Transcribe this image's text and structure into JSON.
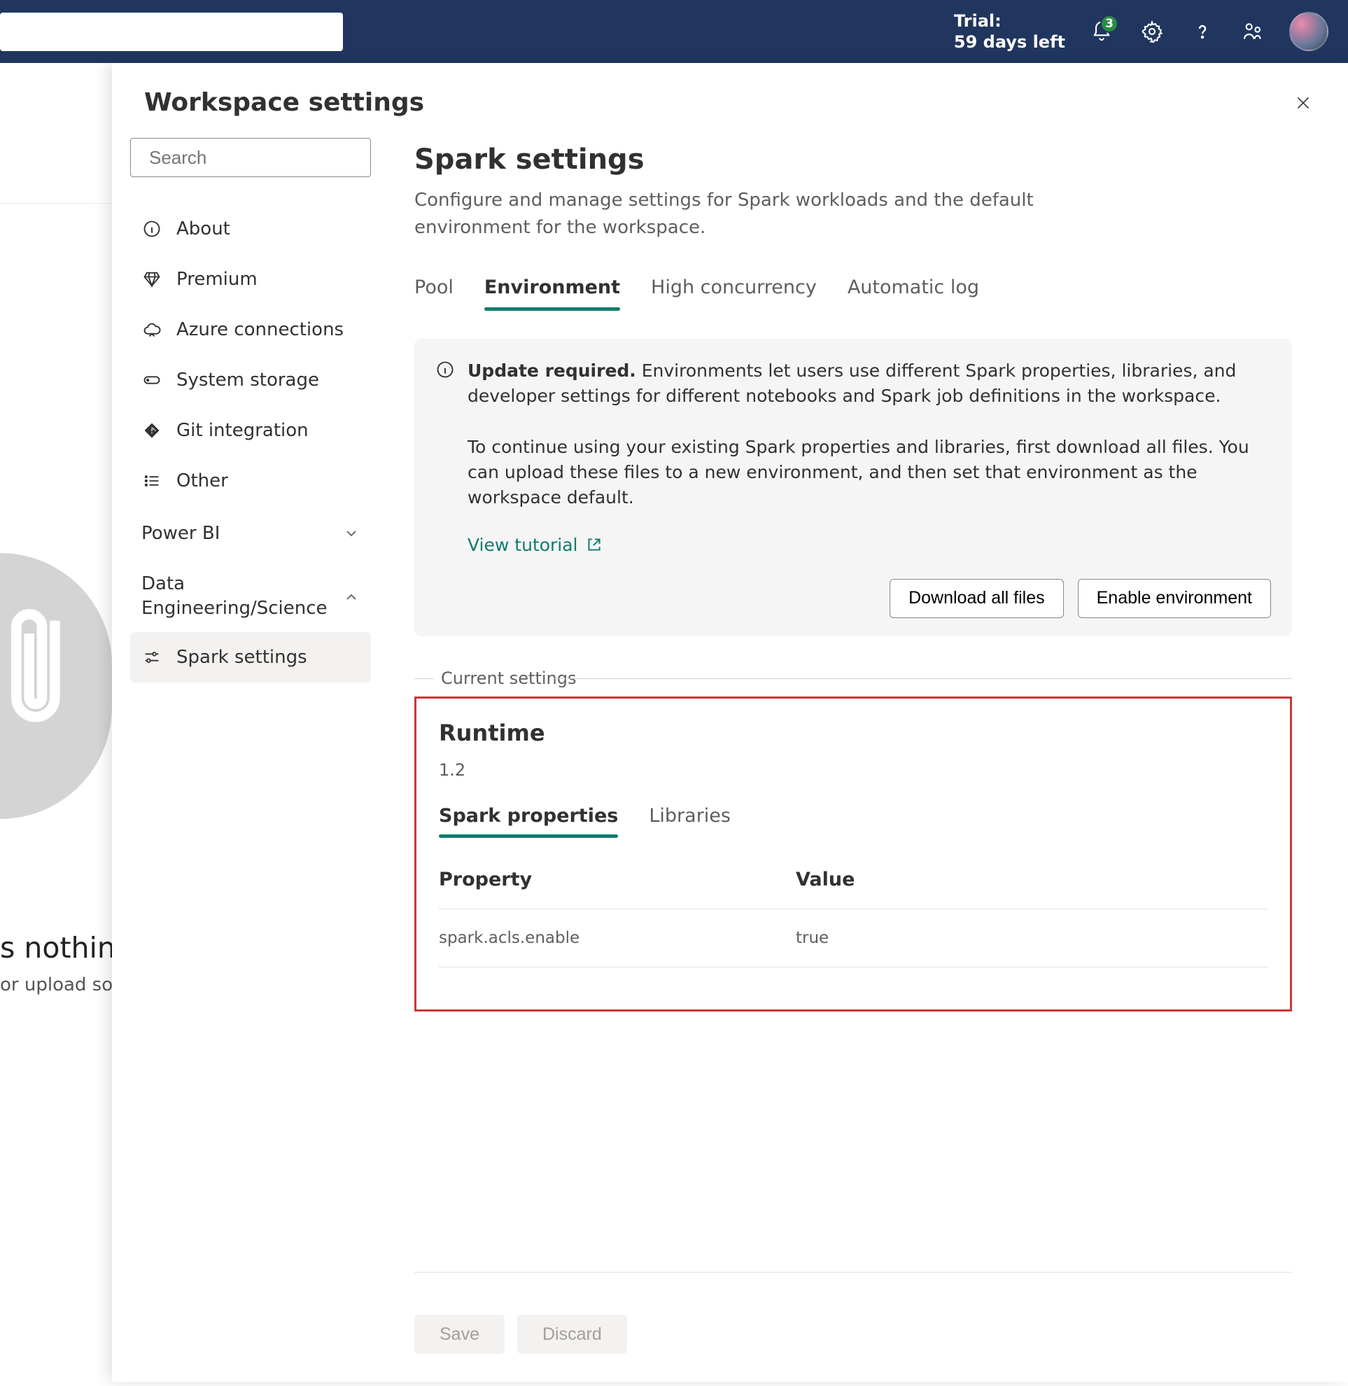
{
  "header": {
    "trial_line1": "Trial:",
    "trial_line2": "59 days left",
    "badge": "3"
  },
  "panel": {
    "title": "Workspace settings",
    "search_placeholder": "Search",
    "sidebar": {
      "items": [
        {
          "label": "About"
        },
        {
          "label": "Premium"
        },
        {
          "label": "Azure connections"
        },
        {
          "label": "System storage"
        },
        {
          "label": "Git integration"
        },
        {
          "label": "Other"
        }
      ],
      "group_powerbi": "Power BI",
      "group_de": "Data Engineering/Science",
      "spark": "Spark settings"
    },
    "main": {
      "title": "Spark settings",
      "desc": "Configure and manage settings for Spark workloads and the default environment for the workspace.",
      "tabs": {
        "pool": "Pool",
        "env": "Environment",
        "hc": "High concurrency",
        "al": "Automatic log"
      },
      "notice": {
        "bold": "Update required.",
        "p1": " Environments let users use different Spark properties, libraries, and developer settings for different notebooks and Spark job definitions in the workspace.",
        "p2": "To continue using your existing Spark properties and libraries, first download all files. You can upload these files to a new environment, and then set that environment as the workspace default.",
        "link": "View tutorial",
        "download": "Download all files",
        "enable": "Enable environment"
      },
      "fieldset": "Current settings",
      "runtime": {
        "title": "Runtime",
        "version": "1.2"
      },
      "subtabs": {
        "sp": "Spark properties",
        "lib": "Libraries"
      },
      "table": {
        "header": {
          "prop": "Property",
          "val": "Value"
        },
        "rows": [
          {
            "prop": "spark.acls.enable",
            "val": "true"
          }
        ]
      },
      "footer": {
        "save": "Save",
        "discard": "Discard"
      }
    }
  },
  "bg": {
    "title": "s nothing",
    "sub": "or upload som"
  }
}
